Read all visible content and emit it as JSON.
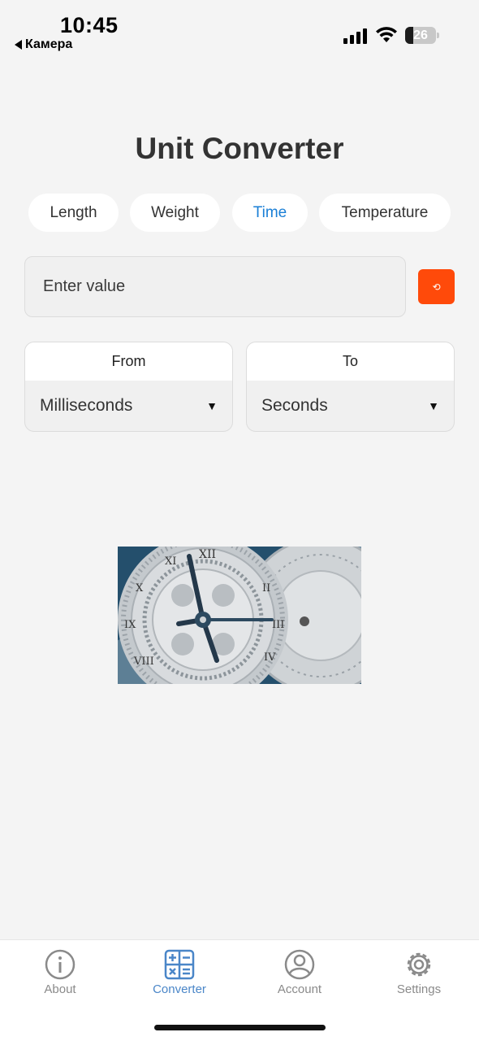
{
  "status_bar": {
    "time": "10:45",
    "back_label": "Камера",
    "battery": "26"
  },
  "title": "Unit Converter",
  "tabs": [
    {
      "label": "Length",
      "active": false
    },
    {
      "label": "Weight",
      "active": false
    },
    {
      "label": "Time",
      "active": true
    },
    {
      "label": "Temperature",
      "active": false
    }
  ],
  "input": {
    "placeholder": "Enter value",
    "value": ""
  },
  "swap_button": {
    "icon": "swap-icon",
    "glyph": "⟲",
    "color": "#ff4a0a"
  },
  "from": {
    "label": "From",
    "selected": "Milliseconds"
  },
  "to": {
    "label": "To",
    "selected": "Seconds"
  },
  "image": {
    "alt": "Clock gears"
  },
  "nav": [
    {
      "label": "About",
      "icon": "info-icon",
      "active": false
    },
    {
      "label": "Converter",
      "icon": "calculator-icon",
      "active": true
    },
    {
      "label": "Account",
      "icon": "user-icon",
      "active": false
    },
    {
      "label": "Settings",
      "icon": "gear-icon",
      "active": false
    }
  ],
  "colors": {
    "accent": "#1a7fd6",
    "nav_active": "#4a86c8",
    "swap": "#ff4a0a",
    "background": "#f4f4f4"
  }
}
